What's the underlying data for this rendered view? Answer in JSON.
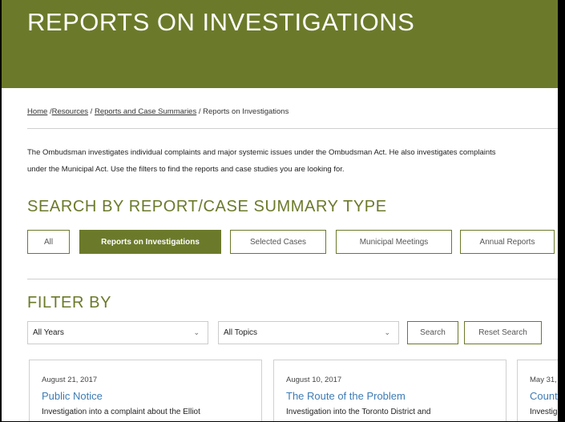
{
  "hero": {
    "title": "REPORTS ON INVESTIGATIONS"
  },
  "breadcrumb": {
    "home": "Home",
    "resources": "Resources",
    "reports_case_summaries": "Reports and Case Summaries",
    "current": "Reports on Investigations"
  },
  "intro": {
    "line1": "The Ombudsman investigates individual complaints and major systemic issues under the Ombudsman Act. He also investigates complaints",
    "line2": "under the Municipal Act. Use the filters to find the reports and case studies you are looking for."
  },
  "search_type": {
    "title": "SEARCH BY REPORT/CASE SUMMARY TYPE",
    "buttons": [
      "All",
      "Reports on Investigations",
      "Selected Cases",
      "Municipal Meetings",
      "Annual Reports"
    ],
    "active": "Reports on Investigations"
  },
  "filter": {
    "title": "FILTER BY",
    "year_select": "All Years",
    "topic_select": "All Topics",
    "search_button": "Search",
    "reset_button": "Reset Search"
  },
  "cards": [
    {
      "date": "August 21, 2017",
      "title": "Public Notice",
      "desc": "Investigation into a complaint about the Elliot"
    },
    {
      "date": "August 10, 2017",
      "title": "The Route of the Problem",
      "desc": "Investigation into the Toronto District and"
    },
    {
      "date": "May 31,",
      "title": "Counter",
      "desc": "Investigation"
    }
  ],
  "colors": {
    "brand": "#6b7a2a",
    "link": "#3d7bb5"
  }
}
